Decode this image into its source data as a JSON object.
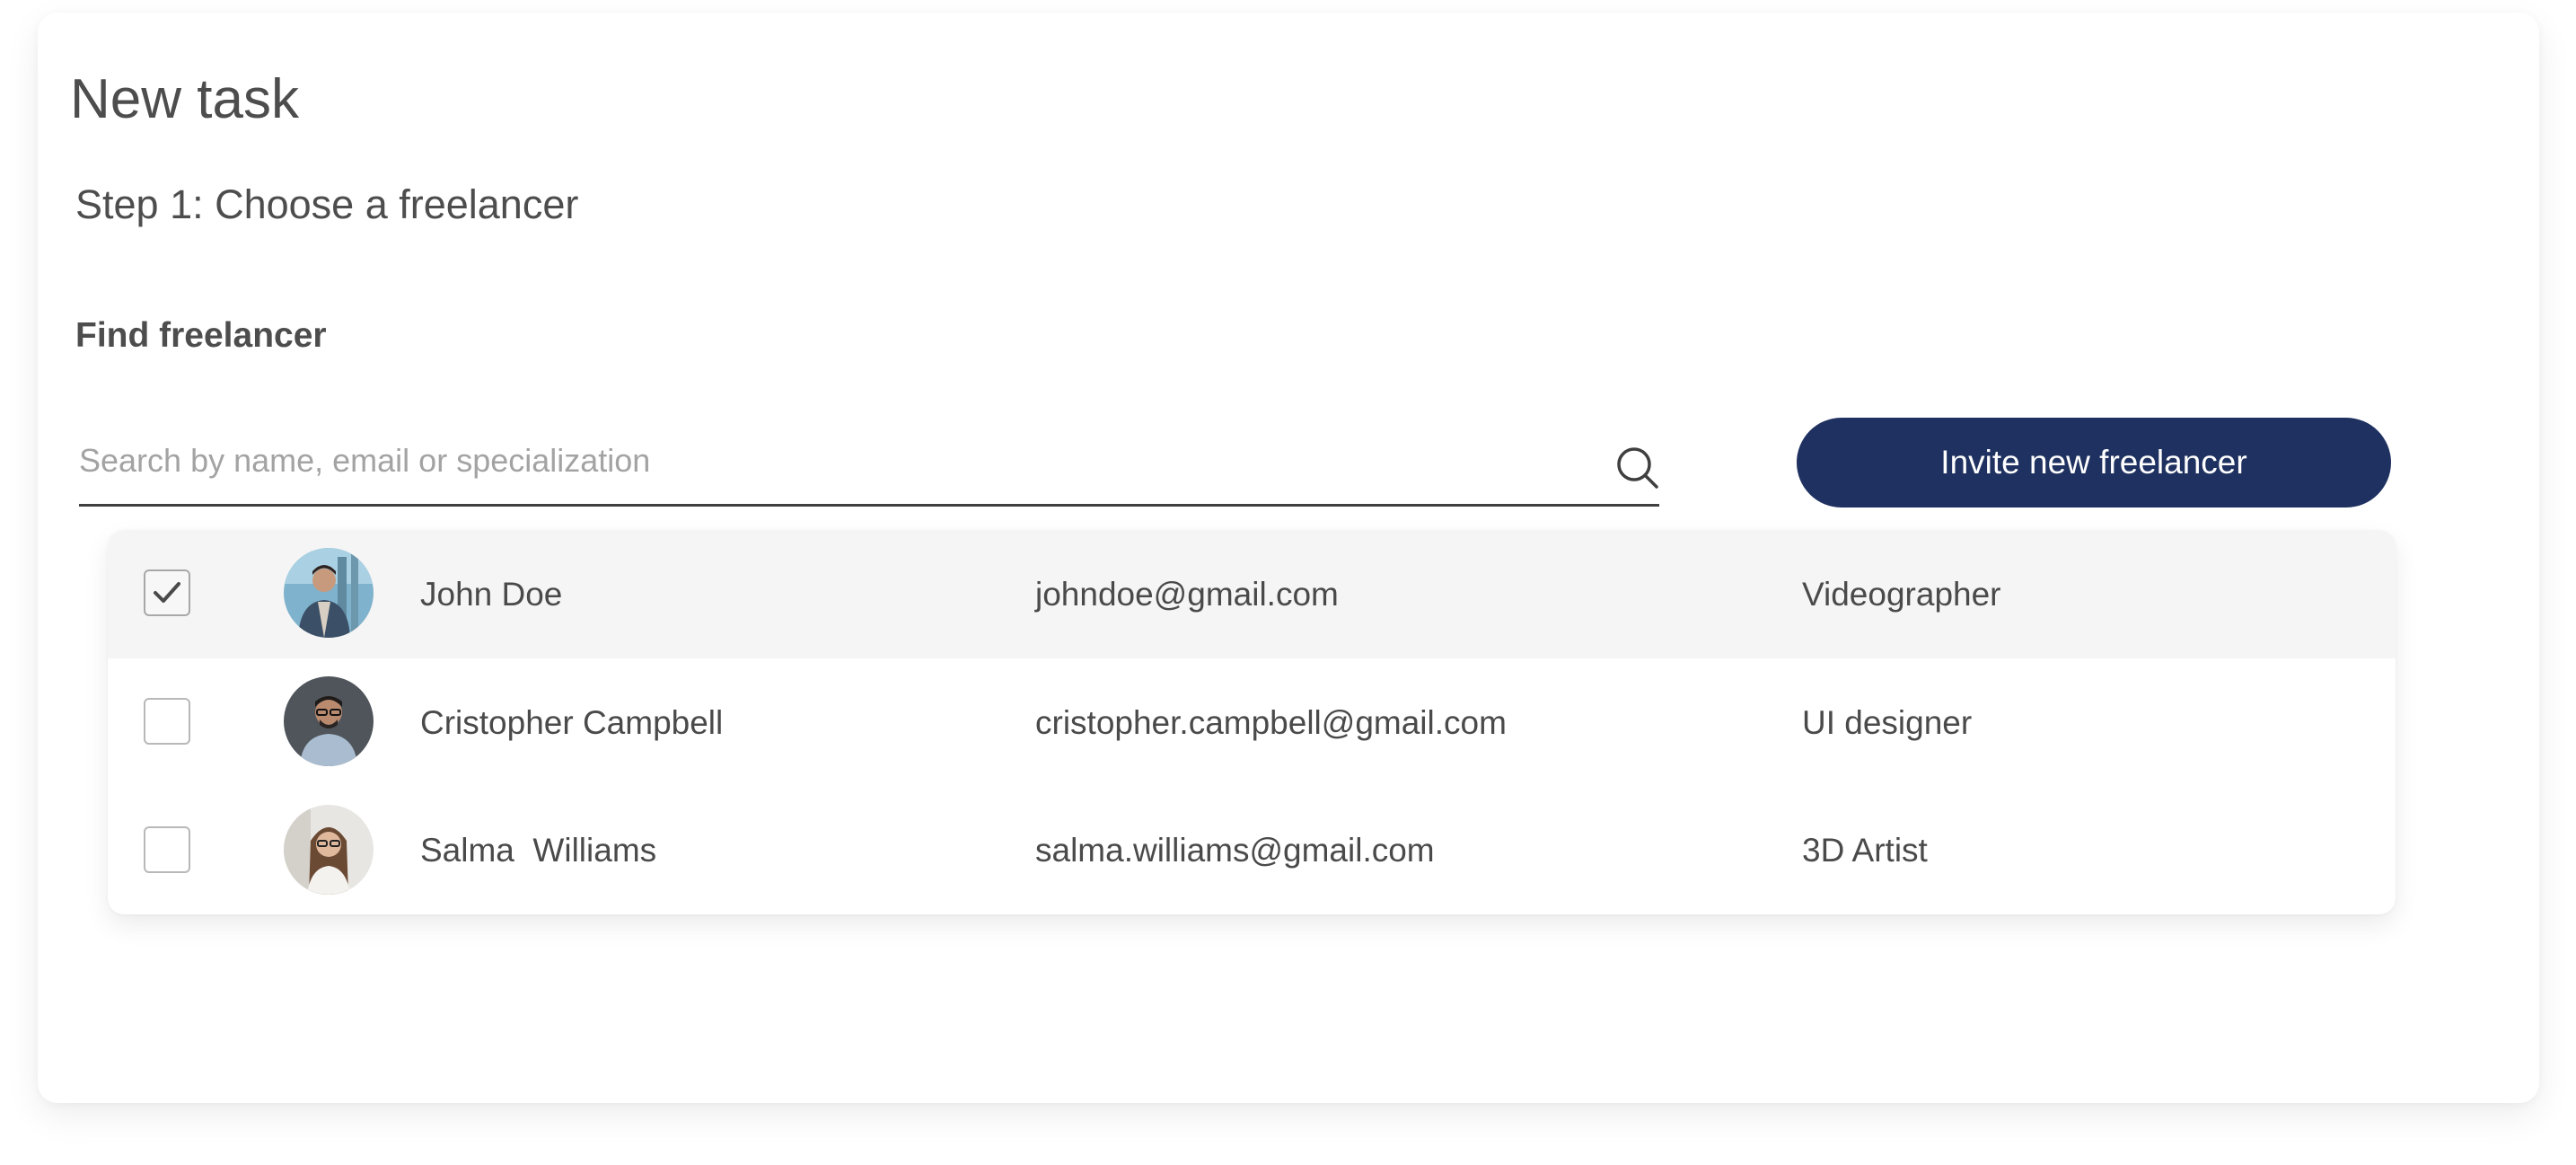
{
  "page": {
    "title": "New task",
    "step_title": "Step 1: Choose a freelancer",
    "find_label": "Find freelancer"
  },
  "search": {
    "placeholder": "Search by name, email or specialization",
    "value": ""
  },
  "invite_button_label": "Invite new freelancer",
  "freelancers": [
    {
      "name": "John Doe",
      "email": "johndoe@gmail.com",
      "specialization": "Videographer",
      "checked": true
    },
    {
      "name": "Cristopher Campbell",
      "email": "cristopher.campbell@gmail.com",
      "specialization": "UI designer",
      "checked": false
    },
    {
      "name": "Salma  Williams",
      "email": "salma.williams@gmail.com",
      "specialization": "3D Artist",
      "checked": false
    }
  ],
  "colors": {
    "accent": "#1f3160",
    "text": "#4a4a4a",
    "placeholder": "#a3a3a3",
    "selected_row": "#f5f5f5"
  },
  "icons": {
    "search": "search-icon",
    "check": "checkmark-icon"
  }
}
